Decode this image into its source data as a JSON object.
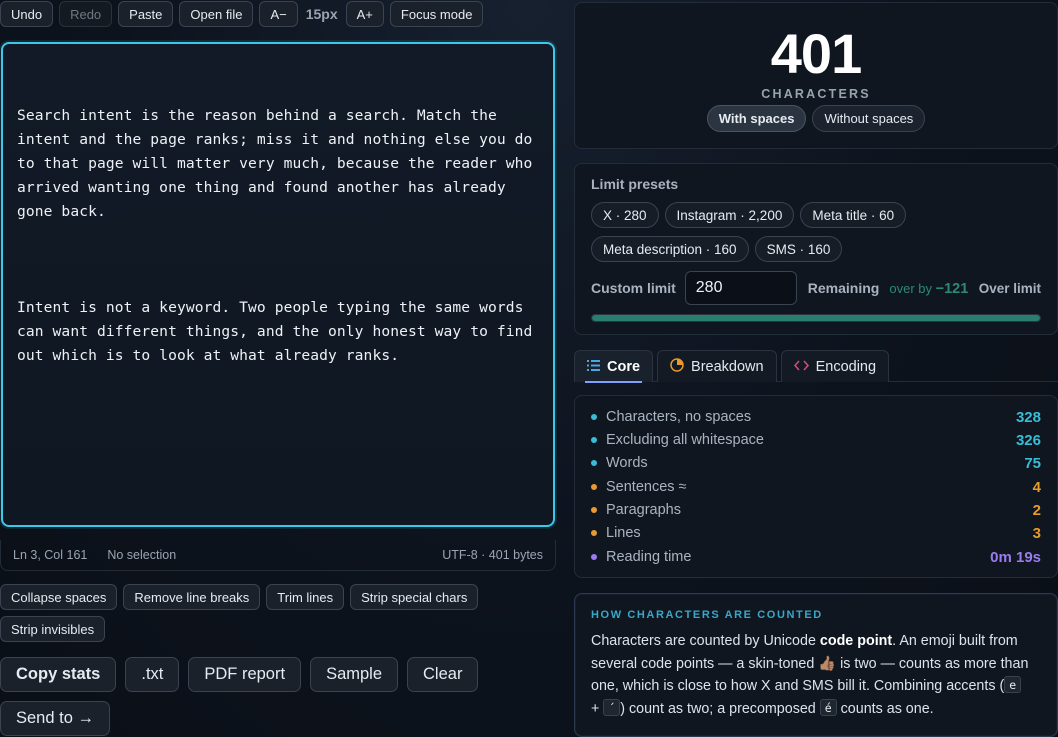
{
  "toolbar": {
    "undo": "Undo",
    "redo": "Redo",
    "paste": "Paste",
    "open_file": "Open file",
    "font_decrease": "A−",
    "font_size": "15px",
    "font_increase": "A+",
    "focus_mode": "Focus mode"
  },
  "editor": {
    "paragraphs": [
      "Search intent is the reason behind a search. Match the\nintent and the page ranks; miss it and nothing else you do\nto that page will matter very much, because the reader who\narrived wanting one thing and found another has already\ngone back.",
      "Intent is not a keyword. Two people typing the same words\ncan want different things, and the only honest way to find\nout which is to look at what already ranks."
    ]
  },
  "status": {
    "cursor": "Ln 3, Col 161",
    "selection": "No selection",
    "encoding": "UTF-8 · 401 bytes"
  },
  "transforms": {
    "collapse_spaces": "Collapse spaces",
    "remove_line_breaks": "Remove line breaks",
    "trim_lines": "Trim lines",
    "strip_special": "Strip special chars",
    "strip_invisibles": "Strip invisibles"
  },
  "actions": {
    "copy_stats": "Copy stats",
    "txt": ".txt",
    "pdf_report": "PDF report",
    "sample": "Sample",
    "clear": "Clear",
    "send_to": "Send to →"
  },
  "counter": {
    "count": "401",
    "label": "CHARACTERS",
    "with_spaces": "With spaces",
    "without_spaces": "Without spaces",
    "active_mode": "with_spaces"
  },
  "limits": {
    "title": "Limit presets",
    "presets": [
      "X · 280",
      "Instagram · 2,200",
      "Meta title · 60",
      "Meta description · 160",
      "SMS · 160"
    ],
    "custom_label": "Custom limit",
    "custom_value": "280",
    "remaining_label": "Remaining",
    "over_by_label": "over by",
    "over_by_value": "−121",
    "over_limit": "Over limit",
    "progress_fraction": 1.0
  },
  "tabs": [
    {
      "label": "Core",
      "icon": "list-icon",
      "active": true
    },
    {
      "label": "Breakdown",
      "icon": "pie-chart-icon",
      "active": false
    },
    {
      "label": "Encoding",
      "icon": "code-icon",
      "active": false
    }
  ],
  "stats": [
    {
      "label": "Characters, no spaces",
      "value": "328",
      "color": "#38bcd8"
    },
    {
      "label": "Excluding all whitespace",
      "value": "326",
      "color": "#38bcd8"
    },
    {
      "label": "Words",
      "value": "75",
      "color": "#38bcd8"
    },
    {
      "label": "Sentences ≈",
      "value": "4",
      "color": "#e89a2c"
    },
    {
      "label": "Paragraphs",
      "value": "2",
      "color": "#e89a2c"
    },
    {
      "label": "Lines",
      "value": "3",
      "color": "#e89a2c"
    },
    {
      "label": "Reading time",
      "value": "0m 19s",
      "color": "#9a7cf0"
    }
  ],
  "info": {
    "title": "HOW CHARACTERS ARE COUNTED",
    "t1": "Characters are counted by Unicode ",
    "t2": "code point",
    "t3": ". An emoji built from several code points — a skin-toned ",
    "emoji": "👍🏽",
    "t4": " is two — counts as more than one, which is close to how X and SMS bill it. Combining accents (",
    "k1": "e",
    "t5": " + ",
    "k2": "´",
    "t6": ") count as two; a precomposed ",
    "k3": "é",
    "t7": " counts as one."
  },
  "colors": {
    "accent": "#3cc8e6",
    "cyan": "#38bcd8",
    "orange": "#e89a2c",
    "purple": "#9a7cf0",
    "progress": "#2a7e70"
  }
}
